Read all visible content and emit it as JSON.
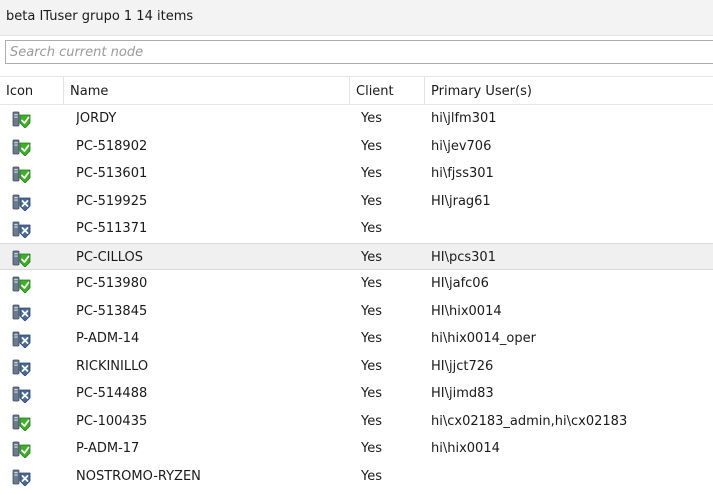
{
  "title": "beta ITuser grupo 1 14 items",
  "search": {
    "placeholder": "Search current node"
  },
  "columns": {
    "icon": "Icon",
    "name": "Name",
    "client": "Client",
    "primary_user": "Primary User(s)"
  },
  "colors": {
    "ok_green": "#3fae29",
    "unknown_blue": "#4a6a9a",
    "selected_row": "#f0f0f0"
  },
  "rows": [
    {
      "icon": "device-ok-icon",
      "name": "JORDY",
      "client": "Yes",
      "primary_user": "hi\\jlfm301"
    },
    {
      "icon": "device-ok-icon",
      "name": "PC-518902",
      "client": "Yes",
      "primary_user": "hi\\jev706"
    },
    {
      "icon": "device-ok-icon",
      "name": "PC-513601",
      "client": "Yes",
      "primary_user": "hi\\fjss301"
    },
    {
      "icon": "device-unknown-icon",
      "name": "PC-519925",
      "client": "Yes",
      "primary_user": "HI\\jrag61"
    },
    {
      "icon": "device-unknown-icon",
      "name": "PC-511371",
      "client": "Yes",
      "primary_user": ""
    },
    {
      "icon": "device-ok-icon",
      "name": "PC-CILLOS",
      "client": "Yes",
      "primary_user": "HI\\pcs301",
      "selected": true
    },
    {
      "icon": "device-ok-icon",
      "name": "PC-513980",
      "client": "Yes",
      "primary_user": "HI\\jafc06"
    },
    {
      "icon": "device-unknown-icon",
      "name": "PC-513845",
      "client": "Yes",
      "primary_user": "HI\\hix0014"
    },
    {
      "icon": "device-unknown-icon",
      "name": "P-ADM-14",
      "client": "Yes",
      "primary_user": "hi\\hix0014_oper"
    },
    {
      "icon": "device-unknown-icon",
      "name": "RICKINILLO",
      "client": "Yes",
      "primary_user": "HI\\jjct726"
    },
    {
      "icon": "device-unknown-icon",
      "name": "PC-514488",
      "client": "Yes",
      "primary_user": "HI\\jimd83"
    },
    {
      "icon": "device-ok-icon",
      "name": "PC-100435",
      "client": "Yes",
      "primary_user": "hi\\cx02183_admin,hi\\cx02183"
    },
    {
      "icon": "device-ok-icon",
      "name": "P-ADM-17",
      "client": "Yes",
      "primary_user": "hi\\hix0014"
    },
    {
      "icon": "device-unknown-icon",
      "name": "NOSTROMO-RYZEN",
      "client": "Yes",
      "primary_user": ""
    }
  ]
}
